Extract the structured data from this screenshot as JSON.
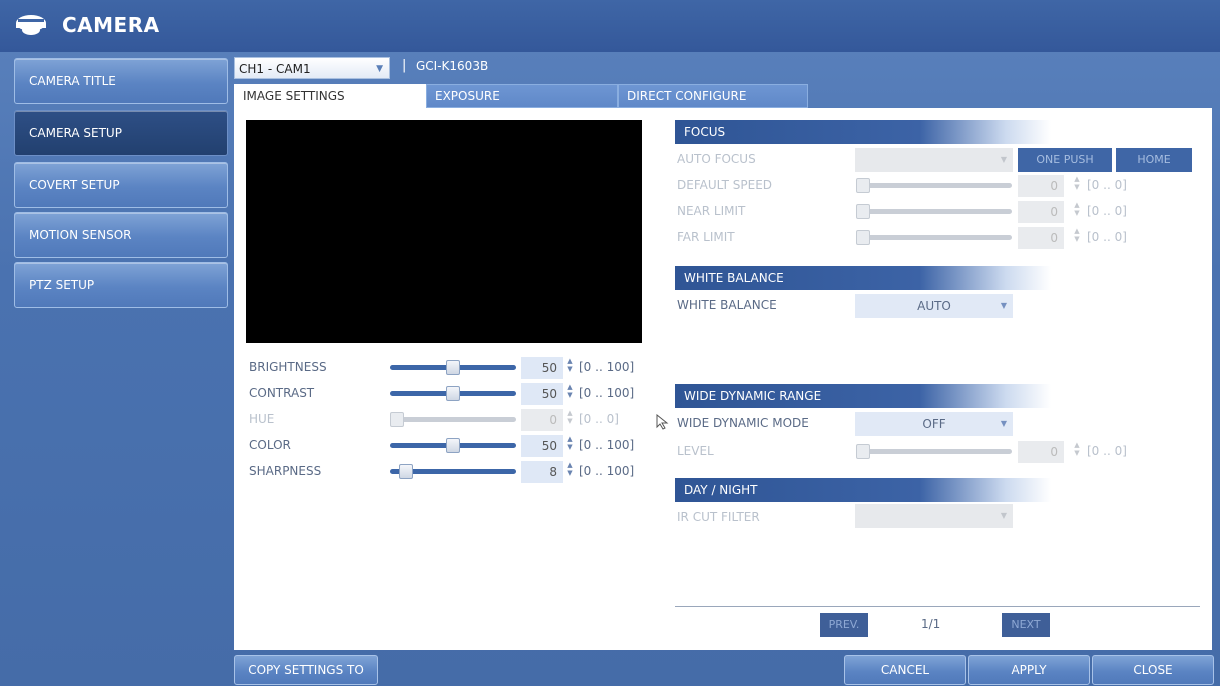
{
  "app": {
    "title": "CAMERA"
  },
  "sidebar": {
    "items": [
      {
        "label": "CAMERA TITLE"
      },
      {
        "label": "CAMERA SETUP"
      },
      {
        "label": "COVERT SETUP"
      },
      {
        "label": "MOTION SENSOR"
      },
      {
        "label": "PTZ SETUP"
      }
    ],
    "active_index": 1
  },
  "channel": {
    "selected": "CH1 - CAM1",
    "separator": "|",
    "model": "GCI-K1603B"
  },
  "tabs": [
    {
      "label": "IMAGE SETTINGS"
    },
    {
      "label": "EXPOSURE"
    },
    {
      "label": "DIRECT CONFIGURE"
    }
  ],
  "image": {
    "rows": [
      {
        "label": "BRIGHTNESS",
        "value": "50",
        "range": "[0 .. 100]",
        "fraction": 0.5,
        "enabled": true
      },
      {
        "label": "CONTRAST",
        "value": "50",
        "range": "[0 .. 100]",
        "fraction": 0.5,
        "enabled": true
      },
      {
        "label": "HUE",
        "value": "0",
        "range": "[0 .. 0]",
        "fraction": 0,
        "enabled": false
      },
      {
        "label": "COLOR",
        "value": "50",
        "range": "[0 .. 100]",
        "fraction": 0.5,
        "enabled": true
      },
      {
        "label": "SHARPNESS",
        "value": "8",
        "range": "[0 .. 100]",
        "fraction": 0.08,
        "enabled": true
      }
    ]
  },
  "focus": {
    "header": "FOCUS",
    "auto_focus_label": "AUTO FOCUS",
    "one_push_label": "ONE PUSH",
    "home_label": "HOME",
    "rows": [
      {
        "label": "DEFAULT SPEED",
        "value": "0",
        "range": "[0 .. 0]"
      },
      {
        "label": "NEAR LIMIT",
        "value": "0",
        "range": "[0 .. 0]"
      },
      {
        "label": "FAR LIMIT",
        "value": "0",
        "range": "[0 .. 0]"
      }
    ]
  },
  "white_balance": {
    "header": "WHITE BALANCE",
    "label": "WHITE BALANCE",
    "value": "AUTO"
  },
  "wdr": {
    "header": "WIDE DYNAMIC RANGE",
    "mode_label": "WIDE DYNAMIC MODE",
    "mode_value": "OFF",
    "level_label": "LEVEL",
    "level_value": "0",
    "level_range": "[0 .. 0]"
  },
  "day_night": {
    "header": "DAY / NIGHT",
    "ir_cut_label": "IR CUT FILTER"
  },
  "pager": {
    "prev": "PREV.",
    "page": "1/1",
    "next": "NEXT"
  },
  "footer": {
    "copy_settings": "COPY SETTINGS TO",
    "cancel": "CANCEL",
    "apply": "APPLY",
    "close": "CLOSE"
  },
  "colors": {
    "accent": "#3f66a6",
    "background": "#4a72b0",
    "active_item": "#22406f"
  }
}
